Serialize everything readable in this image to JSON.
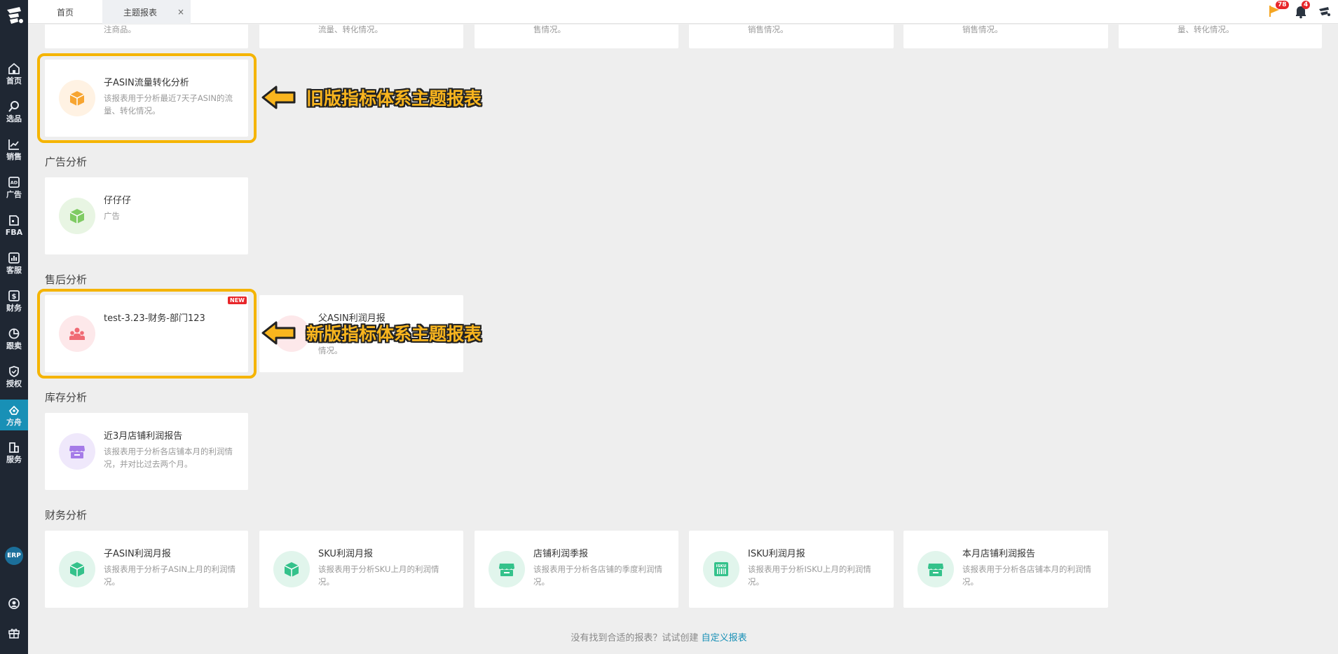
{
  "topbar": {
    "tab_home": "首页",
    "tab_active": "主题报表",
    "close_glyph": "×",
    "flag_badge": "78",
    "bell_badge": "4"
  },
  "sidebar": {
    "items": [
      {
        "label": "首页",
        "icon": "home-icon"
      },
      {
        "label": "选品",
        "icon": "search-icon"
      },
      {
        "label": "销售",
        "icon": "sales-chart-icon"
      },
      {
        "label": "广告",
        "icon": "ad-icon"
      },
      {
        "label": "FBA",
        "icon": "fba-icon"
      },
      {
        "label": "客服",
        "icon": "service-chart-icon"
      },
      {
        "label": "财务",
        "icon": "finance-icon"
      },
      {
        "label": "跟卖",
        "icon": "pie-icon"
      },
      {
        "label": "授权",
        "icon": "shield-icon"
      },
      {
        "label": "方舟",
        "icon": "ark-icon"
      },
      {
        "label": "服务",
        "icon": "building-icon"
      }
    ],
    "erp": "ERP"
  },
  "top_partial_cards": [
    {
      "desc": "注商品。"
    },
    {
      "desc": "流量、转化情况。"
    },
    {
      "desc": "售情况。"
    },
    {
      "desc": "销售情况。"
    },
    {
      "desc": "销售情况。"
    },
    {
      "desc": "量、转化情况。"
    }
  ],
  "old_card": {
    "title": "子ASIN流量转化分析",
    "desc": "该报表用于分析最近7天子ASIN的流量、转化情况。"
  },
  "annotations": {
    "old": "旧版指标体系主题报表",
    "new": "新版指标体系主题报表"
  },
  "sections": {
    "ads": {
      "title": "广告分析",
      "cards": [
        {
          "title": "仔仔仔",
          "desc": "广告"
        }
      ]
    },
    "aftersales": {
      "title": "售后分析",
      "new_tag": "NEW",
      "cards": [
        {
          "title": "test-3.23-财务-部门123",
          "desc": ""
        },
        {
          "title": "父ASIN利润月报",
          "desc": "情况。"
        }
      ]
    },
    "inventory": {
      "title": "库存分析",
      "cards": [
        {
          "title": "近3月店铺利润报告",
          "desc": "该报表用于分析各店铺本月的利润情况，并对比过去两个月。"
        }
      ]
    },
    "finance": {
      "title": "财务分析",
      "cards": [
        {
          "title": "子ASIN利润月报",
          "desc": "该报表用于分析子ASIN上月的利润情况。"
        },
        {
          "title": "SKU利润月报",
          "desc": "该报表用于分析SKU上月的利润情况。"
        },
        {
          "title": "店铺利润季报",
          "desc": "该报表用于分析各店铺的季度利润情况。"
        },
        {
          "title": "ISKU利润月报",
          "desc": "该报表用于分析ISKU上月的利润情况。",
          "icon_text": "ISKU"
        },
        {
          "title": "本月店铺利润报告",
          "desc": "该报表用于分析各店铺本月的利润情况。"
        }
      ]
    }
  },
  "footer": {
    "text": "没有找到合适的报表？试试创建",
    "link": "自定义报表"
  },
  "colors": {
    "sidebar": "#1f2733",
    "active": "#1890b6",
    "highlight": "#f5b400",
    "annotation": "#f9b51e"
  }
}
